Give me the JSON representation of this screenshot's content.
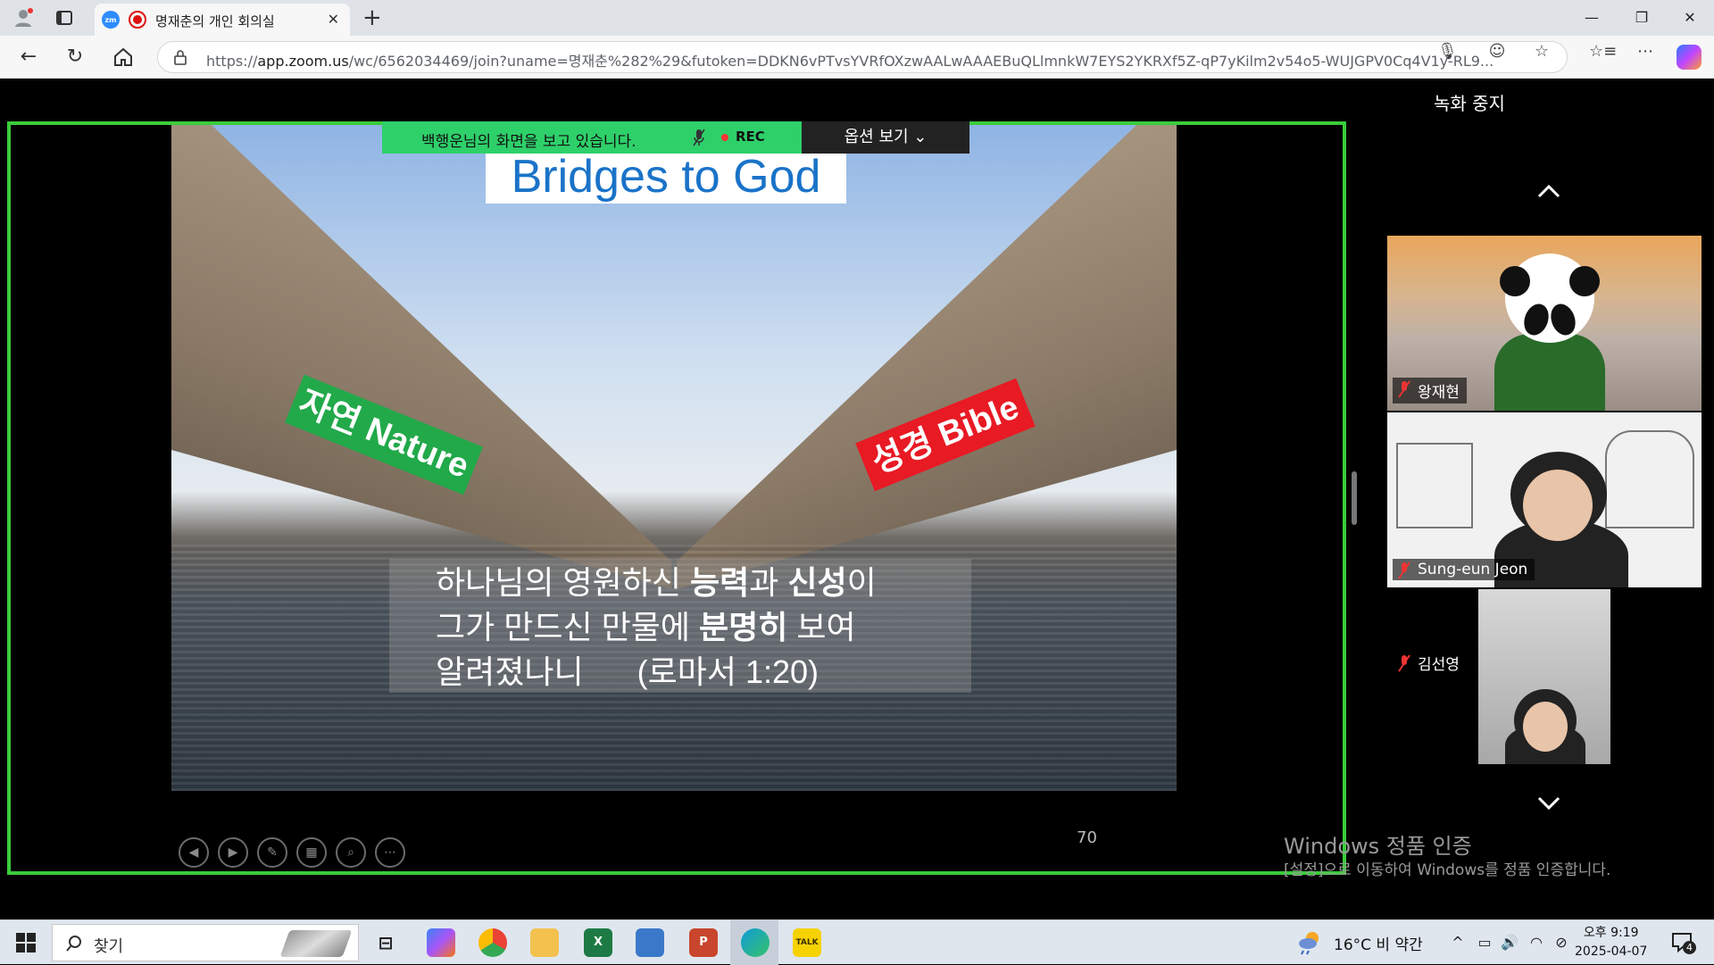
{
  "browser": {
    "tab_title": "명재춘의 개인 회의실",
    "zoom_favicon": "zm",
    "url_prefix": "https://",
    "url_host": "app.zoom.us",
    "url_rest": "/wc/6562034469/join?uname=명재춘%282%29&futoken=DDKN6vPTvsYVRfOXzwAALwAAAEBuQLlmnkW7EYS2YKRXf5Z-qP7yKilm2v54o5-WUJGPV0Cq4V1y-RL9...",
    "window_controls": [
      "—",
      "❐",
      "✕"
    ]
  },
  "zoom": {
    "share_banner": "백행운님의 화면을 보고 있습니다.",
    "rec_label": "REC",
    "options_label": "옵션 보기 ⌄",
    "record_stop": "녹화 중지",
    "page_number": "70",
    "slide": {
      "title": "Bridges to God",
      "label_nature": "자연 Nature",
      "label_bible": "성경 Bible",
      "verse_line1_a": "하나님의 영원하신 ",
      "verse_line1_b": "능력",
      "verse_line1_c": "과 ",
      "verse_line1_d": "신성",
      "verse_line1_e": "이",
      "verse_line2_a": "그가 만드신 만물에 ",
      "verse_line2_b": "분명히",
      "verse_line2_c": " 보여",
      "verse_line3": "알려졌나니      (로마서 1:20)"
    },
    "participants": [
      {
        "name": "왕재현"
      },
      {
        "name": "Sung-eun Jeon"
      },
      {
        "name": "김선영"
      }
    ],
    "slide_controls": [
      "◀",
      "▶",
      "✎",
      "▦",
      "⌕",
      "⋯"
    ]
  },
  "watermark": {
    "title": "Windows 정품 인증",
    "subtitle": "[설정]으로 이동하여 Windows를 정품 인증합니다."
  },
  "taskbar": {
    "search_placeholder": "찾기",
    "weather": "16°C  비 약간",
    "clock_time": "오후 9:19",
    "clock_date": "2025-04-07",
    "excel_label": "X",
    "ppt_label": "P",
    "talk_label": "TALK",
    "notif_count": "4"
  }
}
